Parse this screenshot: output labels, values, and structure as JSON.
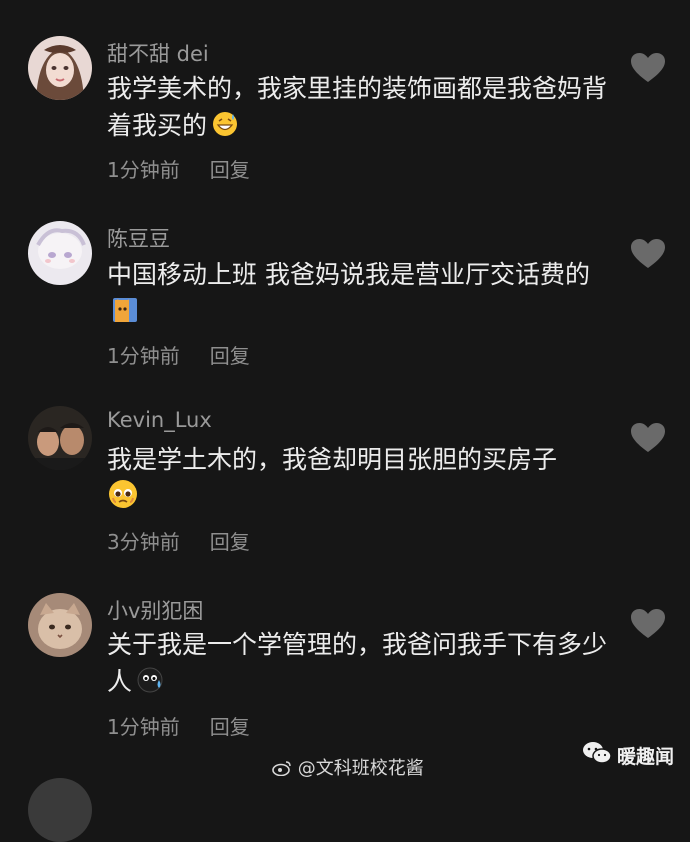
{
  "comments": [
    {
      "username": "甜不甜 dei",
      "text": "我学美术的，我家里挂的装饰画都是我爸妈背着我买的",
      "emoji": "sweat-grin-emoji",
      "time": "1分钟前",
      "reply": "回复"
    },
    {
      "username": "陈豆豆",
      "text": "中国移动上班 我爸妈说我是营业厅交话费的",
      "emoji": "peeking-cat-emoji",
      "time": "1分钟前",
      "reply": "回复"
    },
    {
      "username": "Kevin_Lux",
      "text": "我是学土木的，我爸却明目张胆的买房子",
      "emoji": "pleading-emoji",
      "time": "3分钟前",
      "reply": "回复"
    },
    {
      "username": "小v别犯困",
      "text": "关于我是一个学管理的，我爸问我手下有多少人",
      "emoji": "crying-black-emoji",
      "time": "1分钟前",
      "reply": "回复"
    }
  ],
  "footer": {
    "weibo_handle": "@文科班校花酱",
    "brand": "暖趣闻"
  },
  "colors": {
    "background": "#161616",
    "heart": "#6a6a6a"
  }
}
